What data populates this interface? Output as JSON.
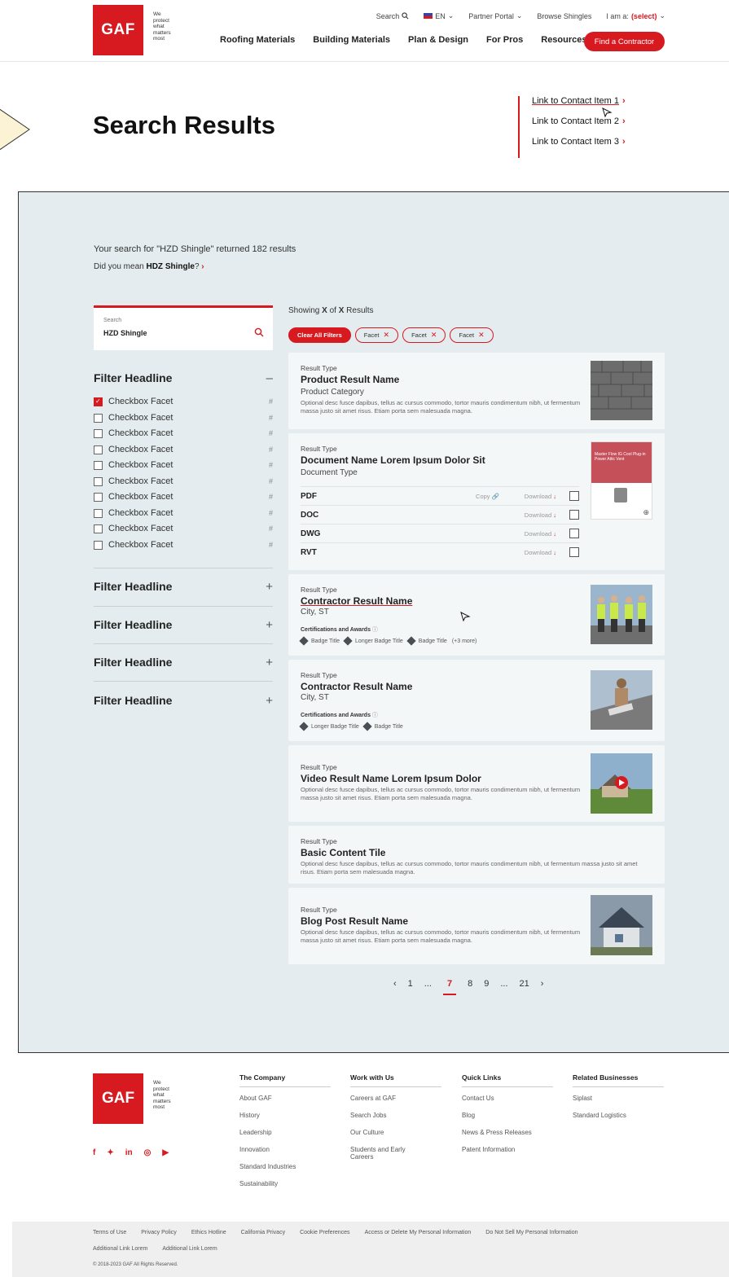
{
  "header": {
    "logo": "GAF",
    "tagline": [
      "We",
      "protect",
      "what",
      "matters",
      "most"
    ],
    "utility": {
      "search": "Search",
      "lang": "EN",
      "partner": "Partner Portal",
      "browse": "Browse Shingles",
      "iam": "I am a:",
      "iam_select": "(select)"
    },
    "nav": [
      "Roofing Materials",
      "Building Materials",
      "Plan & Design",
      "For Pros",
      "Resources"
    ],
    "cta": "Find a Contractor"
  },
  "page": {
    "title": "Search Results",
    "contact_links": [
      "Link to Contact Item 1",
      "Link to Contact Item 2",
      "Link to Contact Item 3"
    ]
  },
  "results": {
    "summary": "Your search for \"HZD Shingle\" returned 182 results",
    "didyou_prefix": "Did you mean",
    "didyou_term": "HDZ Shingle",
    "didyou_suffix": "?",
    "search": {
      "label": "Search",
      "value": "HZD Shingle"
    },
    "showing_prefix": "Showing",
    "showing_x1": "X",
    "showing_of": "of",
    "showing_x2": "X",
    "showing_suffix": "Results",
    "clear_filters": "Clear All Filters",
    "facet_chips": [
      "Facet",
      "Facet",
      "Facet"
    ],
    "filters": [
      {
        "headline": "Filter Headline",
        "toggle": "–",
        "facets": [
          {
            "label": "Checkbox Facet",
            "count": "#",
            "checked": true
          },
          {
            "label": "Checkbox Facet",
            "count": "#",
            "checked": false
          },
          {
            "label": "Checkbox Facet",
            "count": "#",
            "checked": false
          },
          {
            "label": "Checkbox Facet",
            "count": "#",
            "checked": false
          },
          {
            "label": "Checkbox Facet",
            "count": "#",
            "checked": false
          },
          {
            "label": "Checkbox Facet",
            "count": "#",
            "checked": false
          },
          {
            "label": "Checkbox Facet",
            "count": "#",
            "checked": false
          },
          {
            "label": "Checkbox Facet",
            "count": "#",
            "checked": false
          },
          {
            "label": "Checkbox Facet",
            "count": "#",
            "checked": false
          },
          {
            "label": "Checkbox Facet",
            "count": "#",
            "checked": false
          }
        ]
      },
      {
        "headline": "Filter Headline",
        "toggle": "+"
      },
      {
        "headline": "Filter Headline",
        "toggle": "+"
      },
      {
        "headline": "Filter Headline",
        "toggle": "+"
      },
      {
        "headline": "Filter Headline",
        "toggle": "+"
      }
    ],
    "cards": [
      {
        "type": "Result Type",
        "name": "Product Result Name",
        "sub": "Product Category",
        "desc": "Optional desc fusce dapibus, tellus ac cursus commodo, tortor mauris condimentum nibh, ut fermentum massa justo sit amet risus. Etiam porta sem malesuada magna."
      },
      {
        "type": "Result Type",
        "name": "Document Name Lorem Ipsum Dolor Sit",
        "sub": "Document Type",
        "thumb_text": "Master Flow IG Cool Plug-in Power Attic Vent",
        "rows": [
          {
            "label": "PDF",
            "copy": "Copy",
            "download": "Download"
          },
          {
            "label": "DOC",
            "download": "Download"
          },
          {
            "label": "DWG",
            "download": "Download"
          },
          {
            "label": "RVT",
            "download": "Download"
          }
        ]
      },
      {
        "type": "Result Type",
        "name": "Contractor Result Name",
        "sub": "City, ST",
        "cert_label": "Certifications and Awards",
        "badges": [
          "Badge Title",
          "Longer Badge Title",
          "Badge Title"
        ],
        "more": "(+3 more)"
      },
      {
        "type": "Result Type",
        "name": "Contractor Result Name",
        "sub": "City, ST",
        "cert_label": "Certifications and Awards",
        "badges": [
          "Longer Badge Title",
          "Badge Title"
        ]
      },
      {
        "type": "Result Type",
        "name": "Video Result Name Lorem Ipsum Dolor",
        "desc": "Optional desc fusce dapibus, tellus ac cursus commodo, tortor mauris condimentum nibh, ut fermentum massa justo sit amet risus. Etiam porta sem malesuada magna."
      },
      {
        "type": "Result Type",
        "name": "Basic Content Tile",
        "desc": "Optional desc fusce dapibus, tellus ac cursus commodo, tortor mauris condimentum nibh, ut fermentum massa justo sit amet risus. Etiam porta sem malesuada magna."
      },
      {
        "type": "Result Type",
        "name": "Blog Post Result Name",
        "desc": "Optional desc fusce dapibus, tellus ac cursus commodo, tortor mauris condimentum nibh, ut fermentum massa justo sit amet risus. Etiam porta sem malesuada magna."
      }
    ],
    "pagination": {
      "prev": "‹",
      "pages": [
        "1",
        "...",
        "7",
        "8",
        "9",
        "...",
        "21"
      ],
      "current": "7",
      "next": "›"
    }
  },
  "footer": {
    "logo": "GAF",
    "tagline": [
      "We",
      "protect",
      "what",
      "matters",
      "most"
    ],
    "social": [
      "f",
      "y",
      "in",
      "ig",
      "yt"
    ],
    "columns": [
      {
        "heading": "The Company",
        "links": [
          "About GAF",
          "History",
          "Leadership",
          "Innovation",
          "Standard Industries",
          "Sustainability"
        ]
      },
      {
        "heading": "Work with Us",
        "links": [
          "Careers at GAF",
          "Search Jobs",
          "Our Culture",
          "Students and Early Careers"
        ]
      },
      {
        "heading": "Quick Links",
        "links": [
          "Contact Us",
          "Blog",
          "News & Press Releases",
          "Patent Information"
        ]
      },
      {
        "heading": "Related Businesses",
        "links": [
          "Siplast",
          "Standard Logistics"
        ]
      }
    ],
    "legal_links": [
      "Terms of Use",
      "Privacy Policy",
      "Ethics Hotline",
      "California Privacy",
      "Cookie Preferences",
      "Access or Delete My Personal Information",
      "Do Not Sell My Personal Information"
    ],
    "legal_links2": [
      "Additional Link Lorem",
      "Additional Link Lorem"
    ],
    "copyright": "© 2018-2023 GAF All Rights Reserved."
  },
  "colors": {
    "brand": "#d71920",
    "panel_bg": "#e4ecef",
    "card_bg": "#f4f7f8"
  }
}
